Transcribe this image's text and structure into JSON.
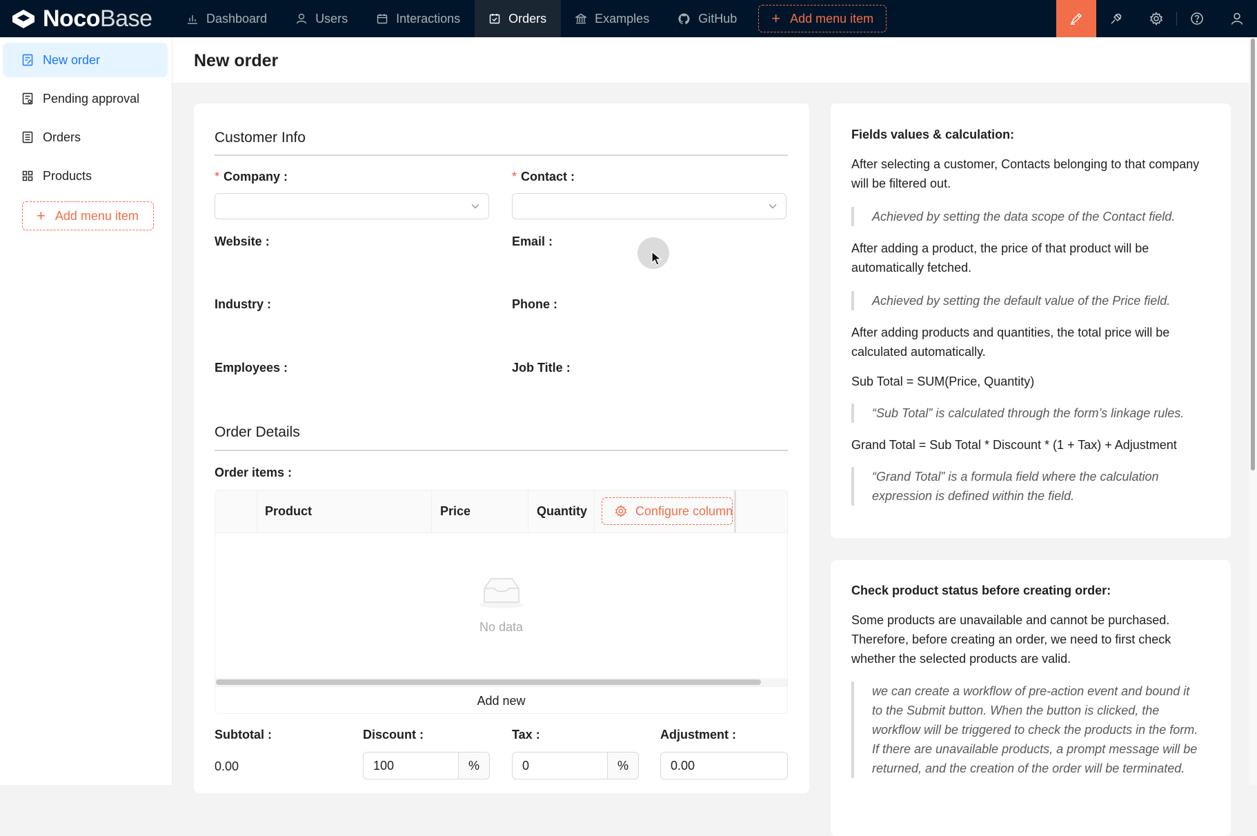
{
  "app": {
    "logo_bold": "Noco",
    "logo_light": "Base"
  },
  "topnav": {
    "items": [
      {
        "label": "Dashboard",
        "icon": "bar-chart-icon"
      },
      {
        "label": "Users",
        "icon": "user-icon"
      },
      {
        "label": "Interactions",
        "icon": "calendar-icon"
      },
      {
        "label": "Orders",
        "icon": "calendar-check-icon",
        "active": true
      },
      {
        "label": "Examples",
        "icon": "bank-icon"
      },
      {
        "label": "GitHub",
        "icon": "github-icon"
      }
    ],
    "add_label": "Add menu item",
    "right_icons": [
      "ui-editor-icon",
      "plugin-icon",
      "settings-icon",
      "help-icon",
      "user-icon"
    ]
  },
  "sidebar": {
    "items": [
      {
        "label": "New order",
        "icon": "form-icon",
        "active": true
      },
      {
        "label": "Pending approval",
        "icon": "audit-icon"
      },
      {
        "label": "Orders",
        "icon": "file-text-icon"
      },
      {
        "label": "Products",
        "icon": "appstore-icon"
      }
    ],
    "add_label": "Add menu item"
  },
  "page": {
    "title": "New order"
  },
  "form": {
    "customer_section": "Customer Info",
    "company_label": "Company",
    "contact_label": "Contact",
    "website_label": "Website",
    "email_label": "Email",
    "industry_label": "Industry",
    "phone_label": "Phone",
    "employees_label": "Employees",
    "job_title_label": "Job Title",
    "order_section": "Order Details",
    "order_items_label": "Order items",
    "table": {
      "columns": [
        "Product",
        "Price",
        "Quantity"
      ],
      "configure_label": "Configure columns",
      "empty_text": "No data",
      "add_new_label": "Add new"
    },
    "subtotal_label": "Subtotal",
    "subtotal_value": "0.00",
    "discount_label": "Discount",
    "discount_value": "100",
    "discount_unit": "%",
    "tax_label": "Tax",
    "tax_value": "0",
    "tax_unit": "%",
    "adjustment_label": "Adjustment",
    "adjustment_value": "0.00"
  },
  "info1": {
    "title": "Fields values & calculation:",
    "p1": "After selecting a customer, Contacts belonging to that company will be filtered out.",
    "q1": "Achieved by setting the data scope of the Contact field.",
    "p2": "After adding a product, the price of that product will be automatically fetched.",
    "q2": "Achieved by setting the default value of the Price field.",
    "p3": "After adding products and quantities, the total price will be calculated automatically.",
    "p4": "Sub Total = SUM(Price, Quantity)",
    "q3": "“Sub Total” is calculated through the form’s linkage rules.",
    "p5": "Grand Total = Sub Total * Discount * (1 + Tax) + Adjustment",
    "q4": "“Grand Total” is a formula field where the calculation expression is defined within the field."
  },
  "info2": {
    "title": "Check product status before creating order:",
    "p1": "Some products are unavailable and cannot be purchased. Therefore, before creating an order, we need to first check whether the selected products are valid.",
    "q1": "we can create a workflow of pre-action event and bound it to the Submit button. When the button is clicked, the workflow will be triggered to check the products in the form. If there are unavailable products, a prompt message will be returned, and the creation of the order will be terminated."
  },
  "colors": {
    "topbar_bg": "#001529",
    "accent": "#f26e48",
    "active_blue": "#1677ff",
    "active_bg": "#e6f4ff",
    "required": "#ff4d4f"
  }
}
